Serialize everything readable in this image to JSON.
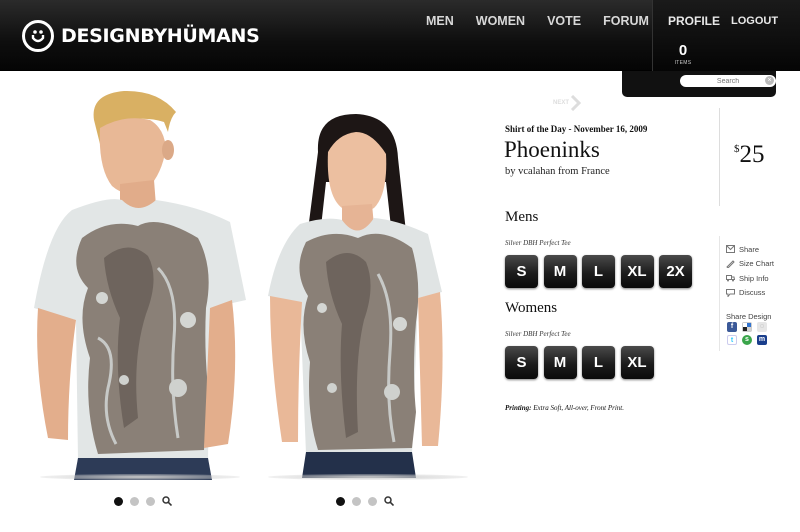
{
  "brand": {
    "name": "DESIGNBYHÜMANS"
  },
  "nav": [
    "MEN",
    "WOMEN",
    "VOTE",
    "FORUM"
  ],
  "account": {
    "profile": "PROFILE",
    "logout": "LOGOUT",
    "cart_count": "0",
    "cart_label": "ITEMS"
  },
  "search": {
    "placeholder": "Search"
  },
  "gallery": {
    "next_label": "NEXT"
  },
  "product": {
    "shirt_of_day": "Shirt of the Day - November 16, 2009",
    "title": "Phoeninks",
    "byline": "by vcalahan from France",
    "price_currency": "$",
    "price_amount": "25",
    "mens": {
      "heading": "Mens",
      "type": "Silver DBH Perfect Tee",
      "sizes": [
        "S",
        "M",
        "L",
        "XL",
        "2X"
      ]
    },
    "womens": {
      "heading": "Womens",
      "type": "Silver DBH Perfect Tee",
      "sizes": [
        "S",
        "M",
        "L",
        "XL"
      ]
    },
    "printing_label": "Printing:",
    "printing_text": "Extra Soft, All-over, Front Print."
  },
  "sidebar": {
    "links": [
      {
        "label": "Share",
        "icon": "mail-icon"
      },
      {
        "label": "Size Chart",
        "icon": "ruler-icon"
      },
      {
        "label": "Ship Info",
        "icon": "truck-icon"
      },
      {
        "label": "Discuss",
        "icon": "chat-icon"
      }
    ],
    "share_title": "Share Design"
  },
  "colors": {
    "header": "#111111",
    "button": "#1c1c1c",
    "shirt": "#dfe3e3",
    "print": "#847a72"
  }
}
